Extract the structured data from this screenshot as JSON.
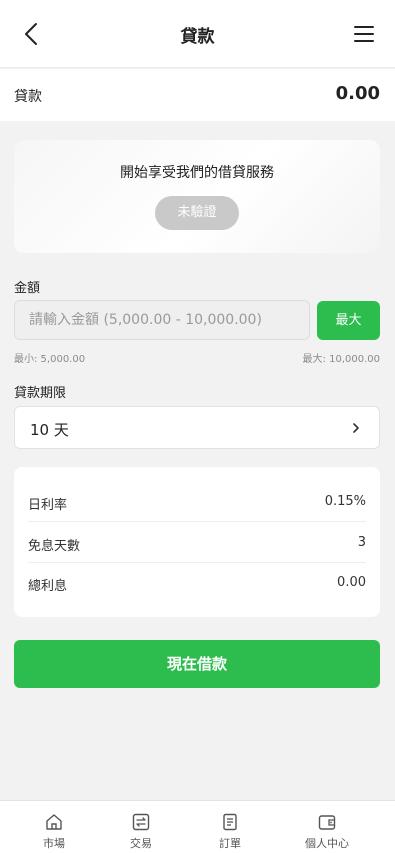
{
  "header": {
    "title": "貸款",
    "back_icon": "chevron-left-icon",
    "menu_icon": "hamburger-menu-icon"
  },
  "balance": {
    "label": "貸款",
    "value": "0.00"
  },
  "promo": {
    "text": "開始享受我們的借貸服務",
    "verify_label": "未驗證"
  },
  "amount": {
    "label": "金額",
    "placeholder": "請輸入金額 (5,000.00 - 10,000.00)",
    "value": "",
    "max_label": "最大",
    "min_hint": "最小: 5,000.00",
    "max_hint": "最大: 10,000.00"
  },
  "term": {
    "label": "貸款期限",
    "value": "10 天",
    "chevron_icon": "chevron-right-icon"
  },
  "details": [
    {
      "label": "日利率",
      "value": "0.15%"
    },
    {
      "label": "免息天數",
      "value": "3"
    },
    {
      "label": "總利息",
      "value": "0.00"
    }
  ],
  "submit_label": "現在借款",
  "tabbar": [
    {
      "label": "市場",
      "icon": "home-icon"
    },
    {
      "label": "交易",
      "icon": "exchange-icon"
    },
    {
      "label": "訂單",
      "icon": "document-icon"
    },
    {
      "label": "個人中心",
      "icon": "wallet-icon"
    }
  ],
  "colors": {
    "accent": "#2dbd4e",
    "disabled": "#c9c9c9",
    "background": "#f2f2f2"
  }
}
